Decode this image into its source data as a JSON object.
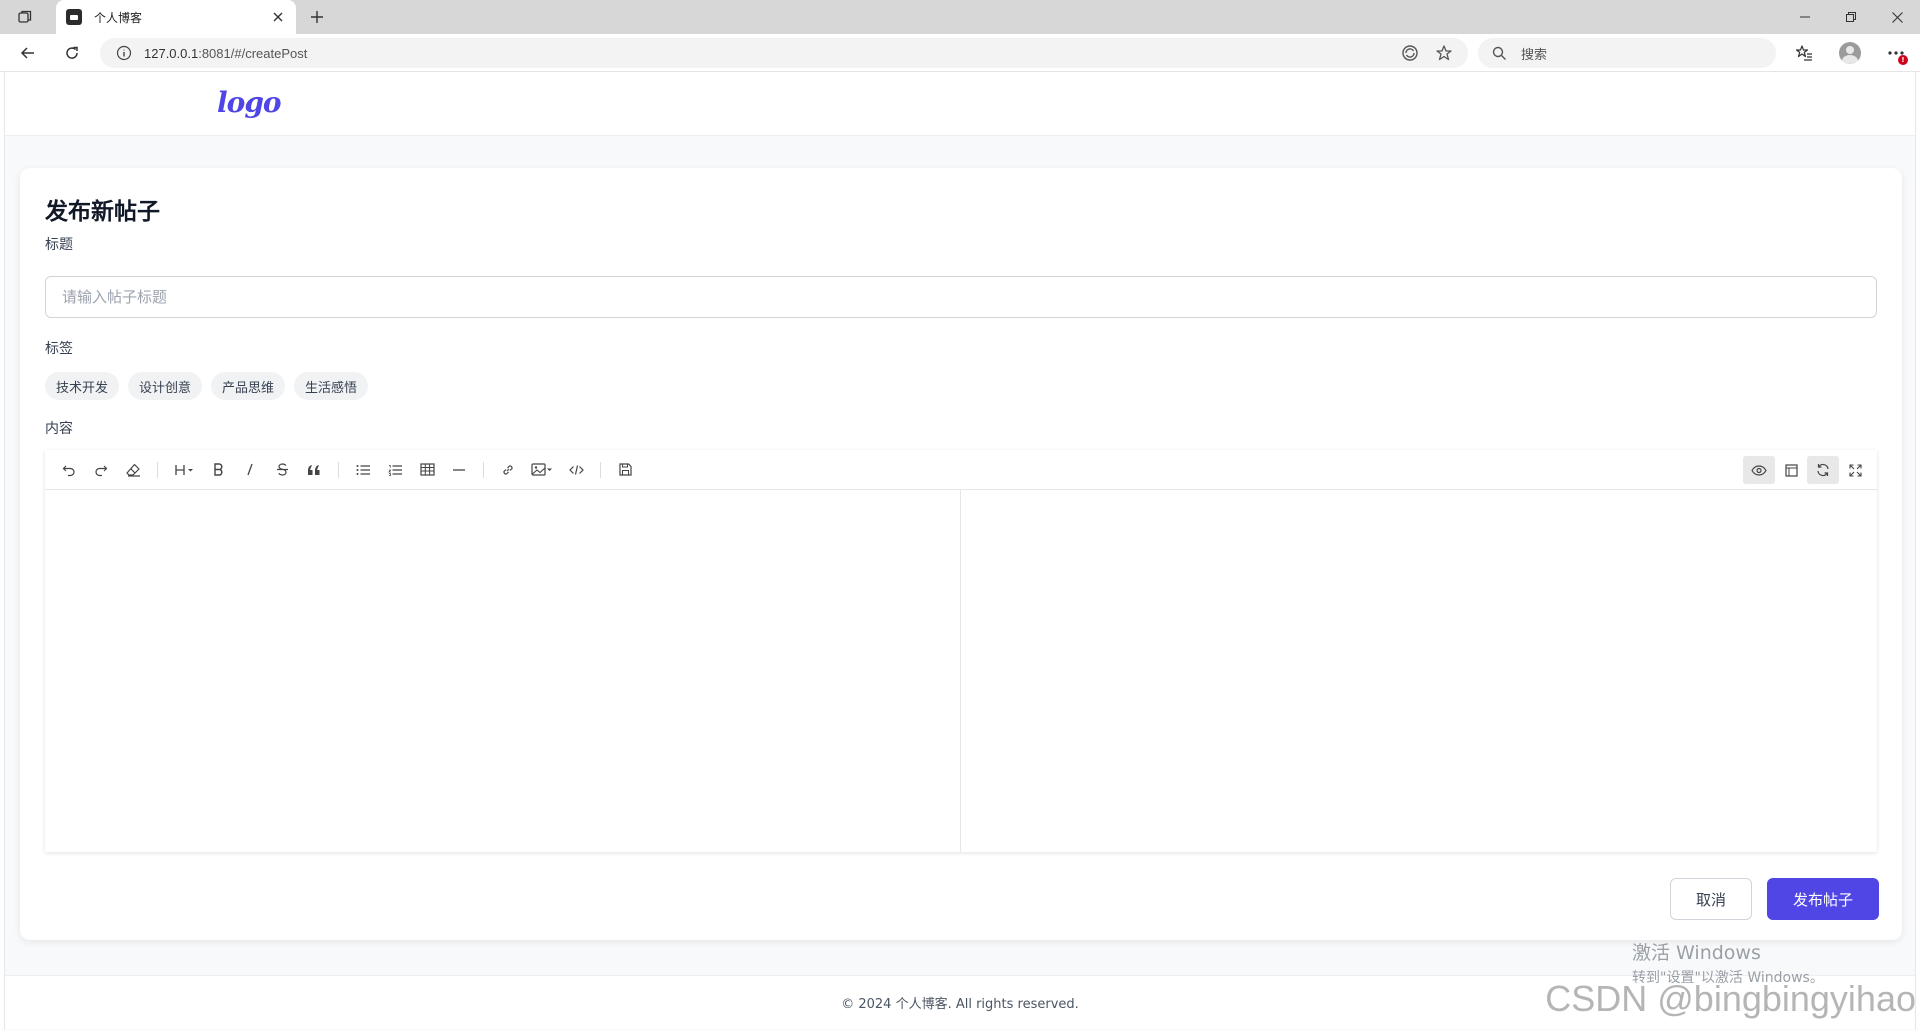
{
  "browser": {
    "tab_title": "个人博客",
    "url_host": "127.0.0.1",
    "url_rest": ":8081/#/createPost",
    "search_placeholder": "搜索"
  },
  "site": {
    "logo_text": "logo"
  },
  "form": {
    "title": "发布新帖子",
    "title_label": "标题",
    "title_placeholder": "请输入帖子标题",
    "tags_label": "标签",
    "tags": [
      "技术开发",
      "设计创意",
      "产品思维",
      "生活感悟"
    ],
    "content_label": "内容",
    "cancel_label": "取消",
    "submit_label": "发布帖子"
  },
  "footer": {
    "copyright": "© 2024 个人博客. All rights reserved."
  },
  "overlay": {
    "activate_line1": "激活 Windows",
    "activate_line2": "转到\"设置\"以激活 Windows。",
    "watermark": "CSDN @bingbingyihao"
  },
  "colors": {
    "primary": "#4f46e5",
    "logo": "#4f46e5"
  }
}
